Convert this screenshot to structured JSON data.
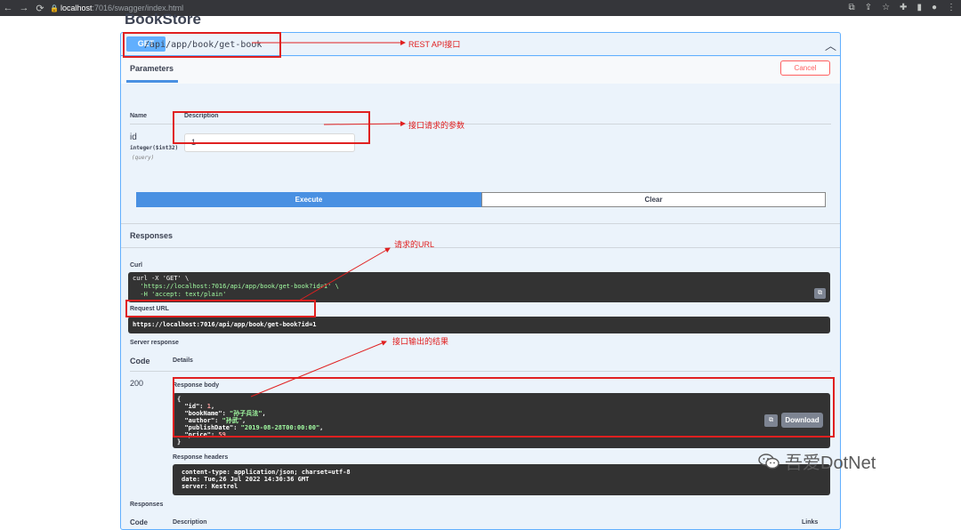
{
  "browser": {
    "url_host": "localhost",
    "url_path": ":7016/swagger/index.html"
  },
  "section_title": "BookStore",
  "operation": {
    "method": "GET",
    "path": "/api/app/book/get-book",
    "tab_parameters": "Parameters",
    "cancel": "Cancel",
    "col_name": "Name",
    "col_description": "Description",
    "param": {
      "name": "id",
      "type": "integer($int32)",
      "in": "(query)",
      "value": "1"
    },
    "execute": "Execute",
    "clear": "Clear",
    "responses_title": "Responses",
    "curl_label": "Curl",
    "curl_lines": [
      "curl -X 'GET' \\",
      "  'https://localhost:7016/api/app/book/get-book?id=1' \\",
      "  -H 'accept: text/plain'"
    ],
    "request_url_label": "Request URL",
    "request_url": "https://localhost:7016/api/app/book/get-book?id=1",
    "server_response_label": "Server response",
    "code_col": "Code",
    "details_col": "Details",
    "status_code": "200",
    "response_body_label": "Response body",
    "response_body": {
      "open": "{",
      "l1_key": "\"id\": ",
      "l1_val": "1",
      "l1_end": ",",
      "l2_key": "\"bookName\": ",
      "l2_val": "\"孙子兵法\"",
      "l2_end": ",",
      "l3_key": "\"author\": ",
      "l3_val": "\"孙武\"",
      "l3_end": ",",
      "l4_key": "\"publishDate\": ",
      "l4_val": "\"2019-08-28T00:00:00\"",
      "l4_end": ",",
      "l5_key": "\"price\": ",
      "l5_val": "59",
      "close": "}"
    },
    "download": "Download",
    "response_headers_label": "Response headers",
    "response_headers": [
      "content-type: application/json; charset=utf-8",
      "date: Tue,26 Jul 2022 14:30:36 GMT",
      "server: Kestrel"
    ],
    "responses_bottom": "Responses",
    "bottom_code": "Code",
    "bottom_description": "Description",
    "bottom_links": "Links"
  },
  "annotations": {
    "rest_api": "REST API接口",
    "params": "接口请求的参数",
    "url": "请求的URL",
    "result": "接口输出的结果"
  },
  "watermark": "吾爱DotNet",
  "colors": {
    "get": "#61affe",
    "annotation": "#e02020",
    "execute": "#4990e2"
  }
}
